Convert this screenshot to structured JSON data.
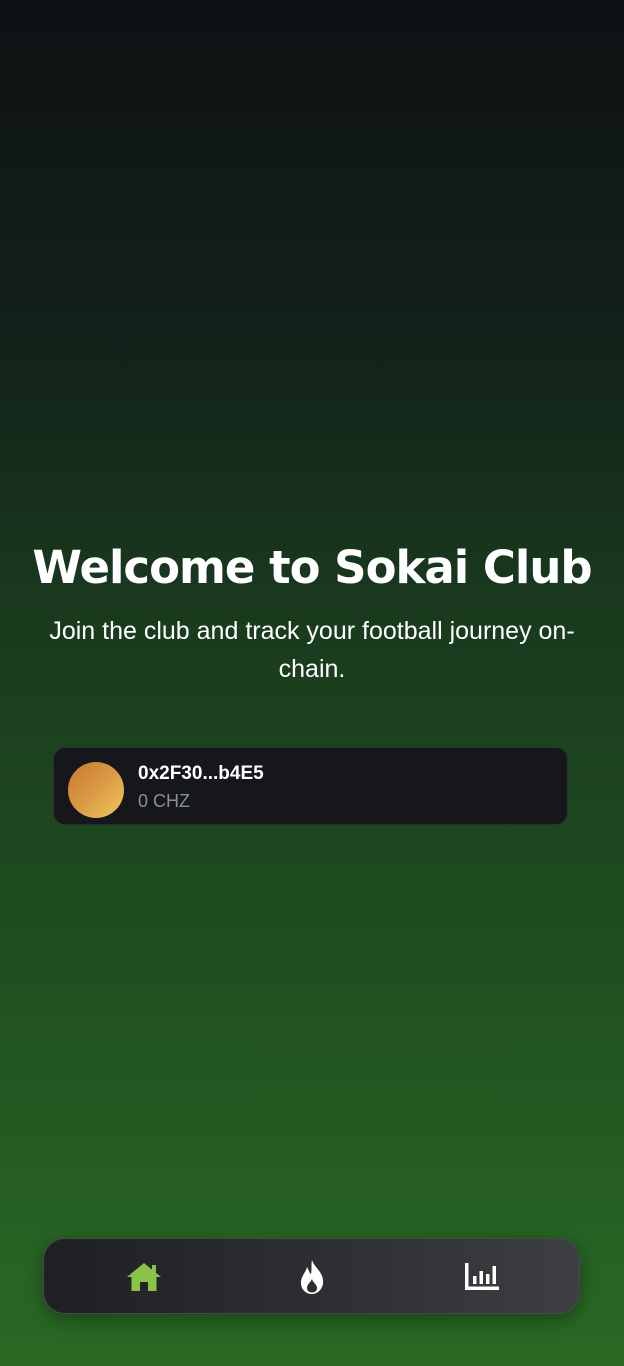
{
  "hero": {
    "title": "Welcome to Sokai Club",
    "subtitle": "Join the club and track your football journey on-chain."
  },
  "wallet": {
    "address": "0x2F30...b4E5",
    "balance": "0 CHZ"
  },
  "nav": {
    "items": [
      {
        "icon": "home-icon",
        "active": true
      },
      {
        "icon": "fire-icon",
        "active": false
      },
      {
        "icon": "bar-chart-icon",
        "active": false
      }
    ]
  },
  "colors": {
    "accent": "#8bc34a",
    "background_top": "#0f1114",
    "background_bottom": "#2a6a24",
    "card": "#15171b"
  }
}
